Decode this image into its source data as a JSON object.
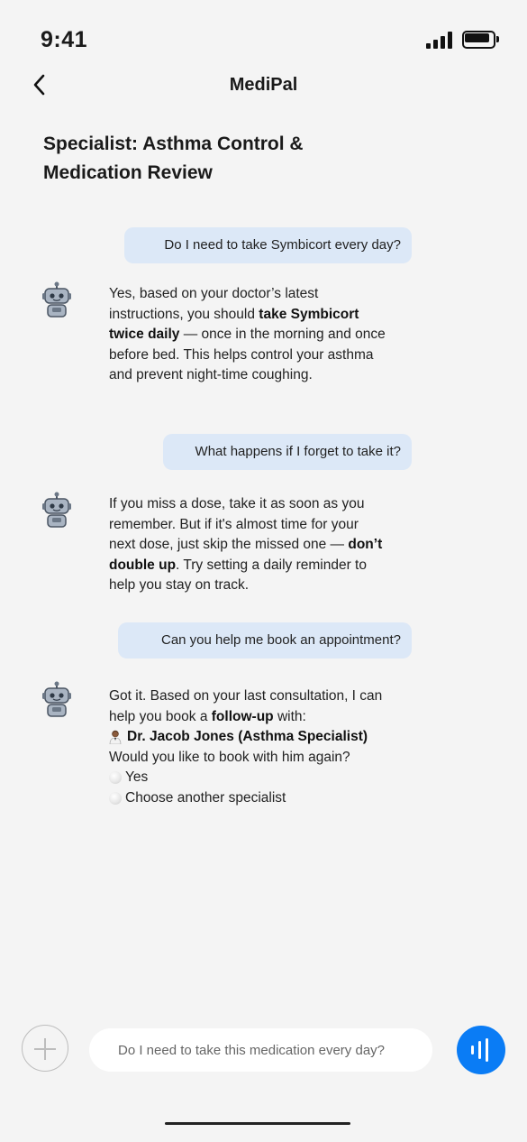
{
  "status": {
    "time": "9:41"
  },
  "nav": {
    "title": "MediPal"
  },
  "page": {
    "title_line1": "Specialist: Asthma Control &",
    "title_line2": "Medication Review"
  },
  "messages": {
    "user1": "Do I need to take Symbicort every day?",
    "bot1": {
      "p1": "Yes, based on your doctor’s latest instructions, you should ",
      "b1": "take Symbicort twice daily",
      "p2": " — once in the morning and once before bed. This helps control your asthma and prevent night-time coughing."
    },
    "user2": "What happens if I forget to take it?",
    "bot2": {
      "p1": "If you miss a dose, take it as soon as you remember. But if it's almost time for your next dose, just skip the missed one — ",
      "b1": "don’t double up",
      "p2": ". Try setting a daily reminder to help you stay on track."
    },
    "user3": "Can you help me book an appointment?",
    "bot3": {
      "p1": "Got it. Based on your last consultation, I can help you book a ",
      "b1": "follow-up",
      "p2": " with:",
      "doctor": "Dr. Jacob Jones (Asthma Specialist)",
      "question": "Would you like to book with him again?",
      "options": [
        "Yes",
        "Choose another specialist"
      ]
    }
  },
  "composer": {
    "placeholder": "Do I need to take this medication every day?"
  },
  "icons": {
    "back": "chevron-left-icon",
    "bot": "robot-icon",
    "add": "plus-icon",
    "voice": "voice-wave-icon",
    "doctor": "doctor-emoji-icon",
    "radio": "radio-icon"
  },
  "colors": {
    "accent": "#0a7cf5",
    "user_bubble": "#dce8f7",
    "background": "#f4f4f4"
  }
}
